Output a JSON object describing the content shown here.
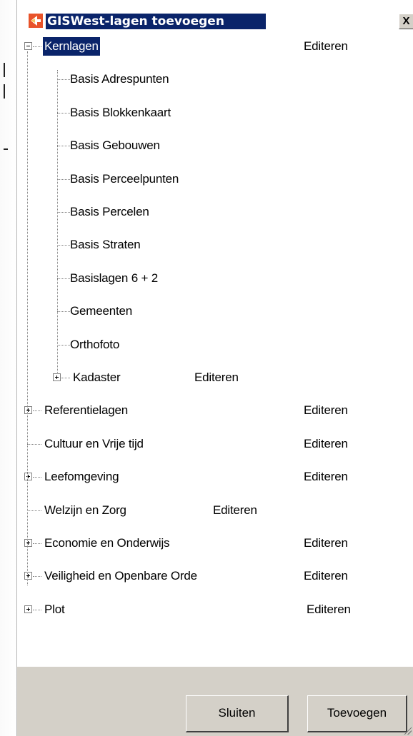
{
  "window": {
    "title": "GISWest-lagen toevoegen",
    "close_glyph": "X",
    "icon": "gis-logo-icon"
  },
  "tree": {
    "edit_label": "Editeren",
    "root": {
      "label": "Kernlagen",
      "edit": "Editeren"
    },
    "children": [
      "Basis Adrespunten",
      "Basis Blokkenkaart",
      "Basis Gebouwen",
      "Basis Perceelpunten",
      "Basis Percelen",
      "Basis Straten",
      "Basislagen 6 + 2",
      "Gemeenten",
      "Orthofoto"
    ],
    "kadaster": {
      "label": "Kadaster",
      "edit": "Editeren"
    },
    "groups": [
      {
        "label": "Referentielagen",
        "edit": "Editeren"
      },
      {
        "label": "Cultuur en Vrije tijd",
        "edit": "Editeren"
      },
      {
        "label": "Leefomgeving",
        "edit": "Editeren"
      },
      {
        "label": "Welzijn en Zorg",
        "edit": "Editeren"
      },
      {
        "label": "Economie en Onderwijs",
        "edit": "Editeren"
      },
      {
        "label": "Veiligheid en Openbare Orde",
        "edit": "Editeren"
      },
      {
        "label": "Plot",
        "edit": "Editeren"
      }
    ]
  },
  "footer": {
    "close_button": "Sluiten",
    "add_button": "Toevoegen"
  },
  "colors": {
    "selection": "#0a246a",
    "dialog_face": "#d4d0c8"
  }
}
